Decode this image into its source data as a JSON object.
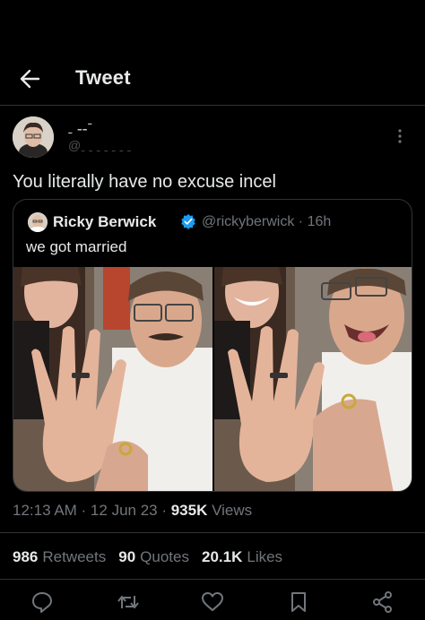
{
  "header": {
    "title": "Tweet",
    "back_icon": "arrow-left-icon"
  },
  "tweet": {
    "author_name": "ˍ  ˗˗ˉ",
    "author_handle": "@ˍ ˍ ˍ ˍ ˍ ˍ ˍ",
    "text": "You literally have no excuse incel",
    "timestamp": "12:13 AM · 12 Jun 23 · ",
    "views_count": "935K",
    "views_label": " Views",
    "stats": [
      {
        "count": "986",
        "label": "Retweets"
      },
      {
        "count": "90",
        "label": "Quotes"
      },
      {
        "count": "20.1K",
        "label": "Likes"
      }
    ]
  },
  "quote": {
    "name": "Ricky Berwick",
    "handle": "@rickyberwick · 16h",
    "text": "we got married",
    "verified_color": "#1d9bf0"
  },
  "actions": [
    "reply-icon",
    "retweet-icon",
    "like-icon",
    "bookmark-icon",
    "share-icon"
  ],
  "colors": {
    "background": "#000000",
    "text": "#e7e9ea",
    "secondary": "#71767b",
    "divider": "#2f3336"
  }
}
